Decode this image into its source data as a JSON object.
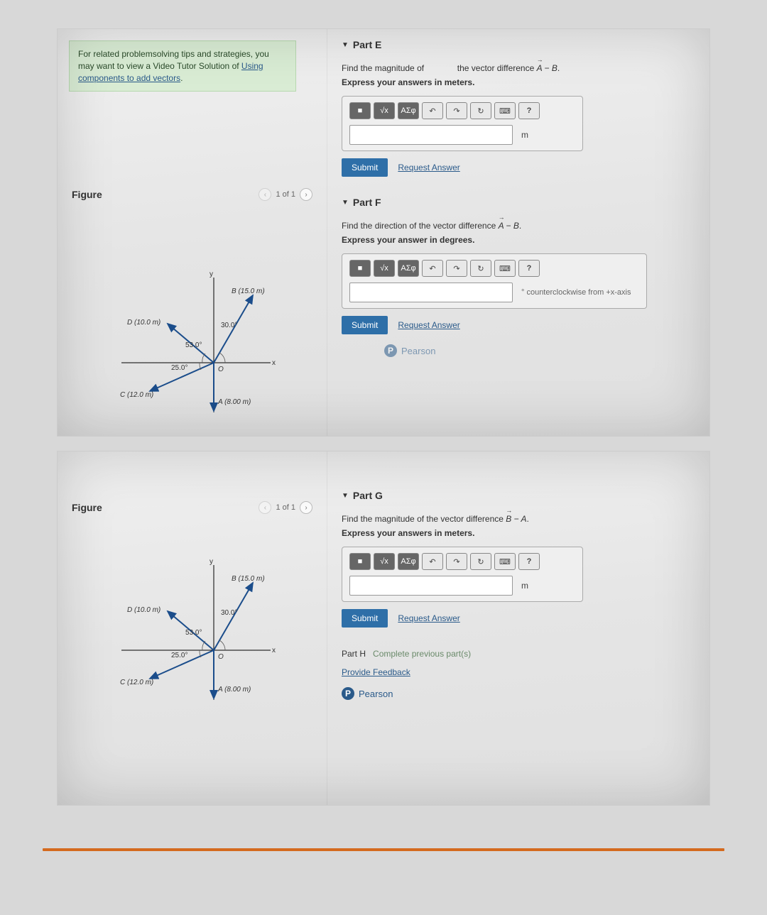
{
  "tips": {
    "pre": "For related problemsolving tips and strategies, you may want to view a Video Tutor Solution of ",
    "link": "Using components to add vectors"
  },
  "figure": {
    "title": "Figure",
    "pager": "1 of 1"
  },
  "vectors": {
    "A": "A (8.00 m)",
    "B": "B (15.0 m)",
    "C": "C (12.0 m)",
    "D": "D (10.0 m)",
    "ang30": "30.0°",
    "ang53": "53.0°",
    "ang25": "25.0°",
    "origin": "O",
    "xaxis": "x",
    "yaxis": "y"
  },
  "toolbar": {
    "t1": "■",
    "t2": "√x",
    "t3": "ΑΣφ",
    "undo": "↶",
    "redo": "↷",
    "reset": "↻",
    "kbd": "⌨",
    "help": "?"
  },
  "partE": {
    "title": "Part E",
    "q1a": "Find the magnitude of",
    "q1b": "the vector difference ",
    "vec": "A − B",
    "q2": "Express your answers in meters.",
    "unit": "m",
    "submit": "Submit",
    "request": "Request Answer"
  },
  "partF": {
    "title": "Part F",
    "q1": "Find the direction of the vector difference ",
    "vec": "A − B",
    "q2": "Express your answer in degrees.",
    "unit": "° counterclockwise from +x-axis",
    "submit": "Submit",
    "request": "Request Answer"
  },
  "partG": {
    "title": "Part G",
    "q1": "Find the magnitude of the vector difference ",
    "vec": "B − A",
    "q2": "Express your answers in meters.",
    "unit": "m",
    "submit": "Submit",
    "request": "Request Answer"
  },
  "partH": {
    "label": "Part H",
    "msg": "Complete previous part(s)"
  },
  "feedback": "Provide Feedback",
  "pearson": "Pearson"
}
